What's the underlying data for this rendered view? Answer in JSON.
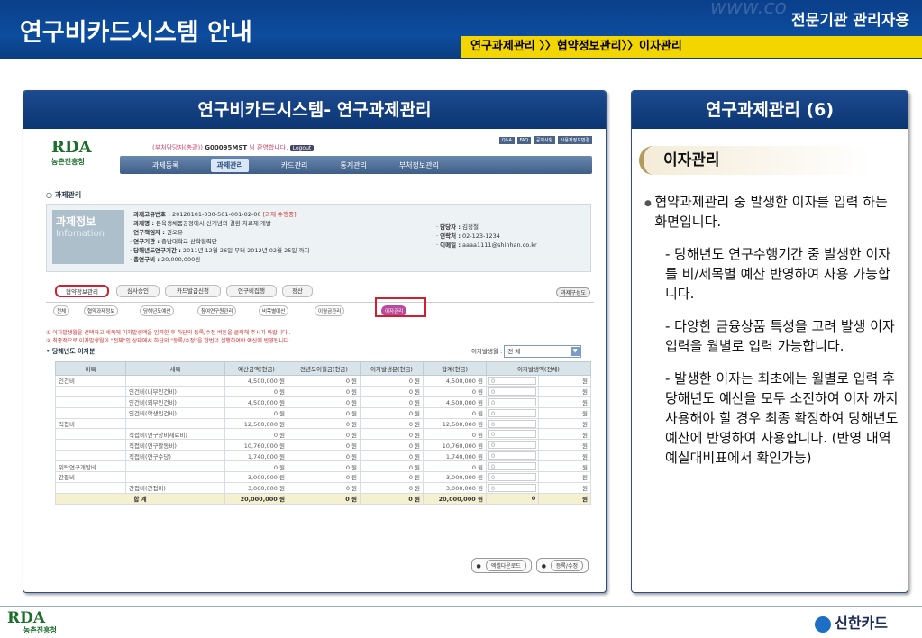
{
  "header": {
    "title": "연구비카드시스템 안내",
    "role": "전문기관 관리자용",
    "breadcrumb": [
      "연구과제관리",
      "〉〉협약정보관리〉〉이자관리"
    ],
    "deco": "www.co"
  },
  "left_panel": {
    "title": "연구비카드시스템- 연구과제관리",
    "screen": {
      "logo": {
        "mark": "RDA",
        "org": "농촌진흥청"
      },
      "welcome_prefix": "(부처담당자(총괄))",
      "welcome_user": "G00095MST",
      "welcome_suffix": "님 환영합니다.",
      "logout": "Logout",
      "util_links": [
        "Q&A",
        "FAQ",
        "공지사항",
        "사용자정보변경"
      ],
      "nav": [
        "과제등록",
        "과제관리",
        "카드관리",
        "통계관리",
        "부처정보관리"
      ],
      "nav_active": 1,
      "section_title": "과제관리",
      "info_badge": {
        "main": "과제정보",
        "sub": "Infomation"
      },
      "info_lines": [
        {
          "label": "과제고유번호 :",
          "value": "20120101-030-501-001-02-00",
          "extra": "[과제 수행중]"
        },
        {
          "label": "과제명 :",
          "value": "돈육생체품공정에서 신개념의 결환 치료제 개발",
          "extra": ""
        },
        {
          "label": "연구책임자 :",
          "value": "권오유",
          "extra": ""
        },
        {
          "label": "연구기관 :",
          "value": "충남대학교 산학협력단",
          "extra": ""
        },
        {
          "label": "당해년도연구기간 :",
          "value": "2011년 12월 26일 부터 2012년 02월 25일 까지",
          "extra": ""
        },
        {
          "label": "총연구비 :",
          "value": "20,000,000원",
          "extra": ""
        }
      ],
      "info_right": [
        {
          "label": "담당자 :",
          "value": "김정철"
        },
        {
          "label": "연락처 :",
          "value": "02-123-1234"
        },
        {
          "label": "이메일 :",
          "value": "aaaa1111@shinhan.co.kr"
        }
      ],
      "tabs": [
        "협약정보관리",
        "심사승인",
        "카드발급신청",
        "연구비집행",
        "정산"
      ],
      "tab_right": "과제구성도",
      "subtabs": [
        "전체",
        "협약과제정보",
        "당해년도예산",
        "참여연구원관리",
        "비목별예산",
        "이월금관리",
        "이자관리"
      ],
      "notes": [
        "① 이자발생월을 선택하고 세목에 이자발생액을 입력한 후 하단의 등록/수정 버튼을 클릭해 주시기 바랍니다 .",
        "② 최종적으로 이자발생월이 \"전체\"인 상태에서 하단의 \"등록/수정\"을 한번더 실행하여야 예산에 반영됩니다 ."
      ],
      "sub_title": "당해년도 이자분",
      "year_label": "이자발생월 :",
      "year_value": "전 체",
      "table": {
        "headers": [
          "비목",
          "세목",
          "예산금액(현금)",
          "전년도이월금(현금)",
          "이자발생분(현금)",
          "합계(현금)",
          "이자발생액(전체)"
        ],
        "rows": [
          [
            "인건비",
            "",
            "4,500,000 원",
            "0 원",
            "0 원",
            "4,500,000 원",
            "0",
            "원"
          ],
          [
            "",
            "인건비(내부인건비)",
            "0 원",
            "0 원",
            "0 원",
            "0 원",
            "0",
            "원"
          ],
          [
            "",
            "인건비(외부인건비)",
            "4,500,000 원",
            "0 원",
            "0 원",
            "4,500,000 원",
            "0",
            "원"
          ],
          [
            "",
            "인건비(학생인건비)",
            "0 원",
            "0 원",
            "0 원",
            "0 원",
            "0",
            "원"
          ],
          [
            "직접비",
            "",
            "12,500,000 원",
            "0 원",
            "0 원",
            "12,500,000 원",
            "0",
            "원"
          ],
          [
            "",
            "직접비(연구장비재료비)",
            "0 원",
            "0 원",
            "0 원",
            "0 원",
            "0",
            "원"
          ],
          [
            "",
            "직접비(연구활동비)",
            "10,760,000 원",
            "0 원",
            "0 원",
            "10,760,000 원",
            "0",
            "원"
          ],
          [
            "",
            "직접비(연구수당)",
            "1,740,000 원",
            "0 원",
            "0 원",
            "1,740,000 원",
            "0",
            "원"
          ],
          [
            "위탁연구개발비",
            "",
            "0 원",
            "0 원",
            "0 원",
            "0 원",
            "0",
            "원"
          ],
          [
            "간접비",
            "",
            "3,000,000 원",
            "0 원",
            "0 원",
            "3,000,000 원",
            "0",
            "원"
          ],
          [
            "",
            "간접비(간접비)",
            "3,000,000 원",
            "0 원",
            "0 원",
            "3,000,000 원",
            "0",
            "원"
          ]
        ],
        "total": [
          "합 계",
          "20,000,000 원",
          "0 원",
          "0 원",
          "20,000,000 원",
          "0",
          "원"
        ]
      },
      "buttons": [
        "엑셀다운로드",
        "등록/수정"
      ]
    }
  },
  "right_panel": {
    "title": "연구과제관리 (6)",
    "section": "이자관리",
    "lead": "협약과제관리 중 발생한 이자를 입력 하는 화면입니다.",
    "items": [
      "- 당해년도 연구수행기간 중 발생한 이자를 비/세목별 예산 반영하여 사용 가능합니다.",
      "- 다양한 금융상품 특성을 고려 발생 이자 입력을 월별로 입력 가능합니다.",
      "- 발생한 이자는 최초에는 월별로 입력 후 당해년도 예산을 모두 소진하여 이자 까지 사용해야 할 경우 최종 확정하여  당해년도 예산에 반영하여 사용합니다. (반영 내역 예실대비표에서 확인가능)"
    ]
  },
  "footer": {
    "logo_mark": "RDA",
    "logo_org": "농촌진흥청",
    "brand": "신한카드"
  },
  "colors": {
    "header_blue": "#0d4c9e",
    "breadcrumb_yellow": "#f3d500",
    "highlight_red": "#d02030"
  }
}
